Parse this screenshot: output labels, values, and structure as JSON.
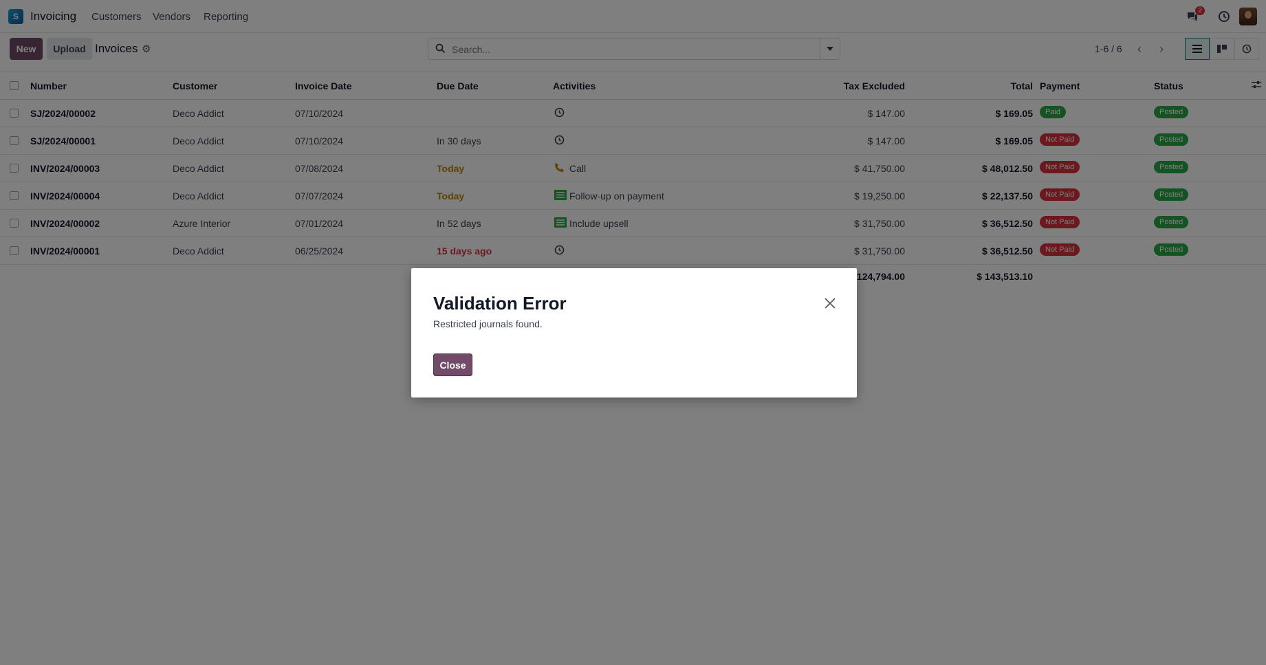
{
  "navbar": {
    "app_name": "Invoicing",
    "logo_letter": "S",
    "menu": [
      "Customers",
      "Vendors",
      "Reporting"
    ],
    "message_count": "2"
  },
  "control_panel": {
    "new_label": "New",
    "upload_label": "Upload",
    "breadcrumb": "Invoices",
    "search_placeholder": "Search...",
    "pager": "1-6 / 6"
  },
  "table": {
    "columns": [
      "Number",
      "Customer",
      "Invoice Date",
      "Due Date",
      "Activities",
      "Tax Excluded",
      "Total",
      "Payment",
      "Status"
    ],
    "rows": [
      {
        "number": "SJ/2024/00002",
        "customer": "Deco Addict",
        "invoice_date": "07/10/2024",
        "due_date": "",
        "due_style": "",
        "activity_icon": "clock-icon",
        "activity": "",
        "tax_excluded": "$ 147.00",
        "total": "$ 169.05",
        "payment": "Paid",
        "status": "Posted"
      },
      {
        "number": "SJ/2024/00001",
        "customer": "Deco Addict",
        "invoice_date": "07/10/2024",
        "due_date": "In 30 days",
        "due_style": "",
        "activity_icon": "clock-icon",
        "activity": "",
        "tax_excluded": "$ 147.00",
        "total": "$ 169.05",
        "payment": "Not Paid",
        "status": "Posted"
      },
      {
        "number": "INV/2024/00003",
        "customer": "Deco Addict",
        "invoice_date": "07/08/2024",
        "due_date": "Today",
        "due_style": "today",
        "activity_icon": "phone-icon",
        "activity": "Call",
        "tax_excluded": "$ 41,750.00",
        "total": "$ 48,012.50",
        "payment": "Not Paid",
        "status": "Posted"
      },
      {
        "number": "INV/2024/00004",
        "customer": "Deco Addict",
        "invoice_date": "07/07/2024",
        "due_date": "Today",
        "due_style": "today",
        "activity_icon": "task-icon",
        "activity": "Follow-up on payment",
        "tax_excluded": "$ 19,250.00",
        "total": "$ 22,137.50",
        "payment": "Not Paid",
        "status": "Posted"
      },
      {
        "number": "INV/2024/00002",
        "customer": "Azure Interior",
        "invoice_date": "07/01/2024",
        "due_date": "In 52 days",
        "due_style": "",
        "activity_icon": "task-icon",
        "activity": "Include upsell",
        "tax_excluded": "$ 31,750.00",
        "total": "$ 36,512.50",
        "payment": "Not Paid",
        "status": "Posted"
      },
      {
        "number": "INV/2024/00001",
        "customer": "Deco Addict",
        "invoice_date": "06/25/2024",
        "due_date": "15 days ago",
        "due_style": "late",
        "activity_icon": "clock-icon",
        "activity": "",
        "tax_excluded": "$ 31,750.00",
        "total": "$ 36,512.50",
        "payment": "Not Paid",
        "status": "Posted"
      }
    ],
    "totals": {
      "tax_excluded": "$ 124,794.00",
      "total": "$ 143,513.10"
    }
  },
  "dialog": {
    "title": "Validation Error",
    "message": "Restricted journals found.",
    "close_label": "Close"
  },
  "colors": {
    "primary": "#714b67",
    "success": "#28a745",
    "danger": "#d9303e",
    "warning_text": "#b8860b"
  }
}
